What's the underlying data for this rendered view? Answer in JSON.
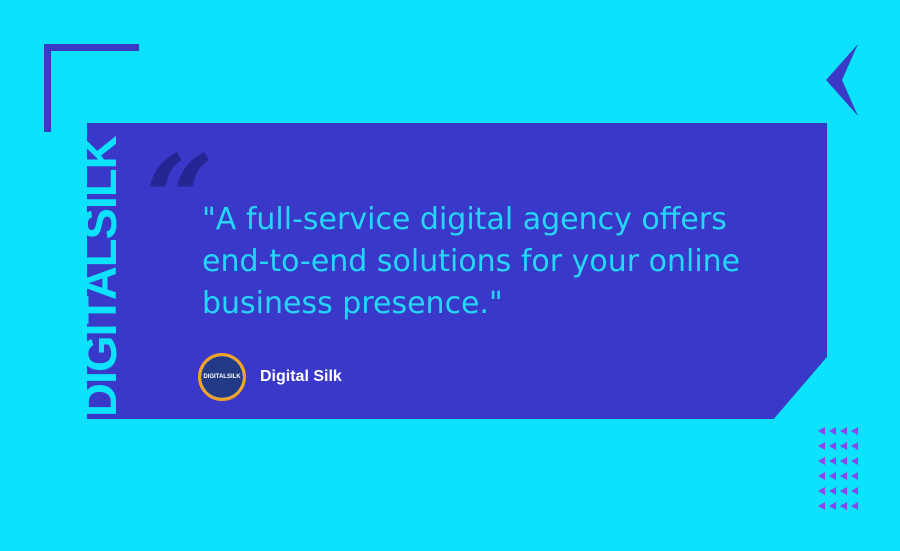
{
  "brand": {
    "name": "DIGITALSILK",
    "avatar_text": "DIGITALSILK"
  },
  "quote": {
    "text": "\"A full-service digital agency offers end-to-end solutions for your online business presence.\"",
    "mark": "“"
  },
  "author": {
    "name": "Digital Silk"
  },
  "colors": {
    "background": "#0ce2fb",
    "card": "#3a38c8",
    "accent": "#f2a324",
    "quote_text": "#25d6fb",
    "dots": "#8b44f0"
  },
  "icons": {
    "corner": "corner-bracket-icon",
    "chevron": "chevron-left-icon",
    "pattern": "triangle-pattern-icon"
  }
}
